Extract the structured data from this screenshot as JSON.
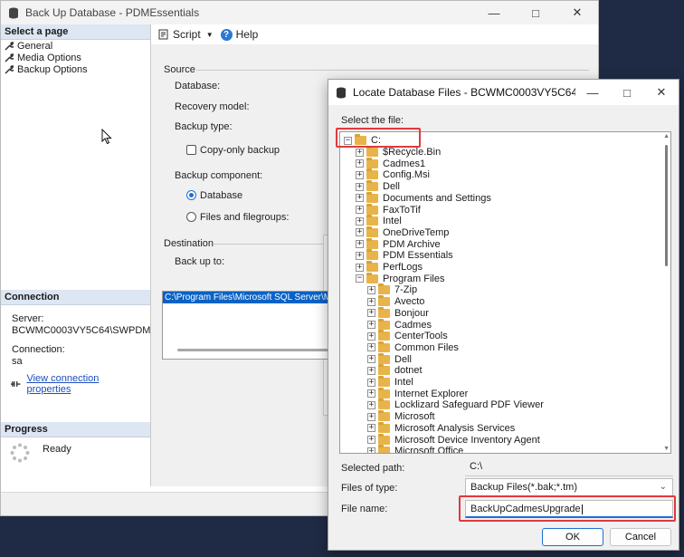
{
  "main_window": {
    "title": "Back Up Database - PDMEssentials",
    "sidebar": {
      "select_header": "Select a page",
      "pages": [
        "General",
        "Media Options",
        "Backup Options"
      ],
      "connection_header": "Connection",
      "server_label": "Server:",
      "server_value": "BCWMC0003VY5C64\\SWPDM",
      "connection_label": "Connection:",
      "connection_value": "sa",
      "view_link": "View connection properties",
      "progress_header": "Progress",
      "progress_status": "Ready"
    },
    "toolbar": {
      "script_label": "Script",
      "help_label": "Help"
    },
    "form": {
      "source_label": "Source",
      "database_label": "Database:",
      "recovery_label": "Recovery model:",
      "backup_type_label": "Backup type:",
      "copy_only_label": "Copy-only backup",
      "component_label": "Backup component:",
      "database_radio": "Database",
      "files_radio": "Files and filegroups:",
      "destination_label": "Destination",
      "backup_to_label": "Back up to:",
      "destination_path": "C:\\Program Files\\Microsoft SQL Server\\MS"
    }
  },
  "dialog": {
    "title": "Locate Database Files - BCWMC0003VY5C64\\SWP...",
    "select_file_label": "Select the file:",
    "tree": [
      {
        "label": "C:",
        "level": 0,
        "expander": "−"
      },
      {
        "label": "$Recycle.Bin",
        "level": 1,
        "expander": "+"
      },
      {
        "label": "Cadmes1",
        "level": 1,
        "expander": "+"
      },
      {
        "label": "Config.Msi",
        "level": 1,
        "expander": "+"
      },
      {
        "label": "Dell",
        "level": 1,
        "expander": "+"
      },
      {
        "label": "Documents and Settings",
        "level": 1,
        "expander": "+"
      },
      {
        "label": "FaxToTif",
        "level": 1,
        "expander": "+"
      },
      {
        "label": "Intel",
        "level": 1,
        "expander": "+"
      },
      {
        "label": "OneDriveTemp",
        "level": 1,
        "expander": "+"
      },
      {
        "label": "PDM Archive",
        "level": 1,
        "expander": "+"
      },
      {
        "label": "PDM Essentials",
        "level": 1,
        "expander": "+"
      },
      {
        "label": "PerfLogs",
        "level": 1,
        "expander": "+"
      },
      {
        "label": "Program Files",
        "level": 1,
        "expander": "−"
      },
      {
        "label": "7-Zip",
        "level": 2,
        "expander": "+"
      },
      {
        "label": "Avecto",
        "level": 2,
        "expander": "+"
      },
      {
        "label": "Bonjour",
        "level": 2,
        "expander": "+"
      },
      {
        "label": "Cadmes",
        "level": 2,
        "expander": "+"
      },
      {
        "label": "CenterTools",
        "level": 2,
        "expander": "+"
      },
      {
        "label": "Common Files",
        "level": 2,
        "expander": "+"
      },
      {
        "label": "Dell",
        "level": 2,
        "expander": "+"
      },
      {
        "label": "dotnet",
        "level": 2,
        "expander": "+"
      },
      {
        "label": "Intel",
        "level": 2,
        "expander": "+"
      },
      {
        "label": "Internet Explorer",
        "level": 2,
        "expander": "+"
      },
      {
        "label": "Locklizard Safeguard PDF Viewer",
        "level": 2,
        "expander": "+"
      },
      {
        "label": "Microsoft",
        "level": 2,
        "expander": "+"
      },
      {
        "label": "Microsoft Analysis Services",
        "level": 2,
        "expander": "+"
      },
      {
        "label": "Microsoft Device Inventory Agent",
        "level": 2,
        "expander": "+"
      },
      {
        "label": "Microsoft Office",
        "level": 2,
        "expander": "+"
      }
    ],
    "selected_path_label": "Selected path:",
    "selected_path_value": "C:\\",
    "files_type_label": "Files of type:",
    "files_type_value": "Backup Files(*.bak;*.tm)",
    "file_name_label": "File name:",
    "file_name_value": "BackUpCadmesUpgrade",
    "ok_label": "OK",
    "cancel_label": "Cancel"
  },
  "colors": {
    "highlight": "#e0393d",
    "accent": "#1f6fd1",
    "selection": "#0a62c6"
  }
}
